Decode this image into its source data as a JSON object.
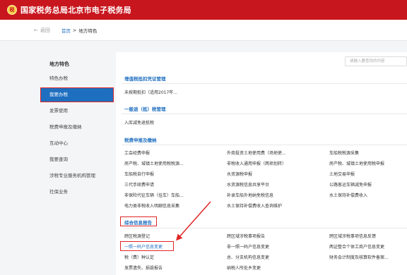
{
  "header": {
    "title": "国家税务总局北京市电子税务局",
    "emblem_text": "税",
    "bg_color": "#c8161e"
  },
  "subnav": {
    "back_label": "返回",
    "breadcrumb": [
      "首页",
      "地方特色"
    ],
    "separator": ">"
  },
  "sidebar": {
    "heading": "地方特色",
    "items": [
      "特色办税",
      "我要办税",
      "发票使用",
      "税费申报及缴纳",
      "互动中心",
      "我要查询",
      "涉税专业服务机构管理",
      "社保业务"
    ],
    "active_index": 1
  },
  "search": {
    "placeholder": "请输入要查找的内容"
  },
  "sections": [
    {
      "title": "增值税抵扣凭证管理",
      "rows": [
        [
          "未按期抵扣（适用2017年...",
          "",
          ""
        ]
      ]
    },
    {
      "title": "一般退（抵）税管理",
      "rows": [
        [
          "入库减免退抵税",
          "",
          ""
        ]
      ]
    },
    {
      "title": "税费申报及缴纳",
      "rows": [
        [
          "工会经费申报",
          "外商投资土地使用费（场地使...",
          "车船税税源采集"
        ],
        [
          "房产税、城镇土地使用税税源...",
          "非税收入通用申报（两项划转）",
          "房产税、城镇土地使用税申报"
        ],
        [
          "车船税自行申报",
          "水资源税申报",
          "土地交易申报"
        ],
        [
          "三代手续费申请",
          "水资源税信息共享平台",
          "公路客运车辆减免申报"
        ],
        [
          "非保险代征车辆（挂车）车船...",
          "补录车船外地纳免税信息",
          "水土保持补偿费收入"
        ],
        [
          "电力类非税收入明细信息采集",
          "水土保持补偿费收入查询维护",
          ""
        ]
      ]
    },
    {
      "title": "综合信息报告",
      "rows": [
        [
          "跨区税源登记",
          "跨区域涉税事项报告",
          "跨区域涉税事项信息反馈"
        ],
        [
          "一照一码户信息变更",
          "非一照一码户信息变更",
          "两证整合个体工商户信息变更"
        ],
        [
          "税（费）种认定",
          "总、分支机构信息变更",
          "财务会计制度及核算软件备案..."
        ],
        [
          "发票遗失、损毁报告",
          "纳税人所处乡变更",
          ""
        ]
      ]
    }
  ]
}
